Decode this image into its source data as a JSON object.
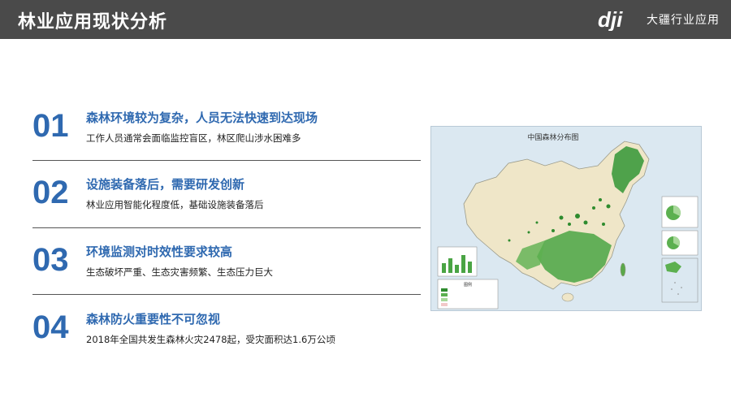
{
  "header": {
    "title": "林业应用现状分析",
    "brand_logo_text": "dji",
    "brand_name": "大疆行业应用"
  },
  "items": [
    {
      "number": "01",
      "title": "森林环境较为复杂，人员无法快速到达现场",
      "description": "工作人员通常会面临监控盲区，林区爬山涉水困难多"
    },
    {
      "number": "02",
      "title": "设施装备落后，需要研发创新",
      "description": "林业应用智能化程度低，基础设施装备落后"
    },
    {
      "number": "03",
      "title": "环境监测对时效性要求较高",
      "description": "生态破坏严重、生态灾害频繁、生态压力巨大"
    },
    {
      "number": "04",
      "title": "森林防火重要性不可忽视",
      "description": "2018年全国共发生森林火灾2478起，受灾面积达1.6万公顷"
    }
  ],
  "map": {
    "title": "中国森林分布图",
    "legend_title": "图例"
  },
  "colors": {
    "header_bg": "#4a4a4a",
    "accent_blue": "#2f69b0",
    "forest_green": "#2e8b2e"
  }
}
